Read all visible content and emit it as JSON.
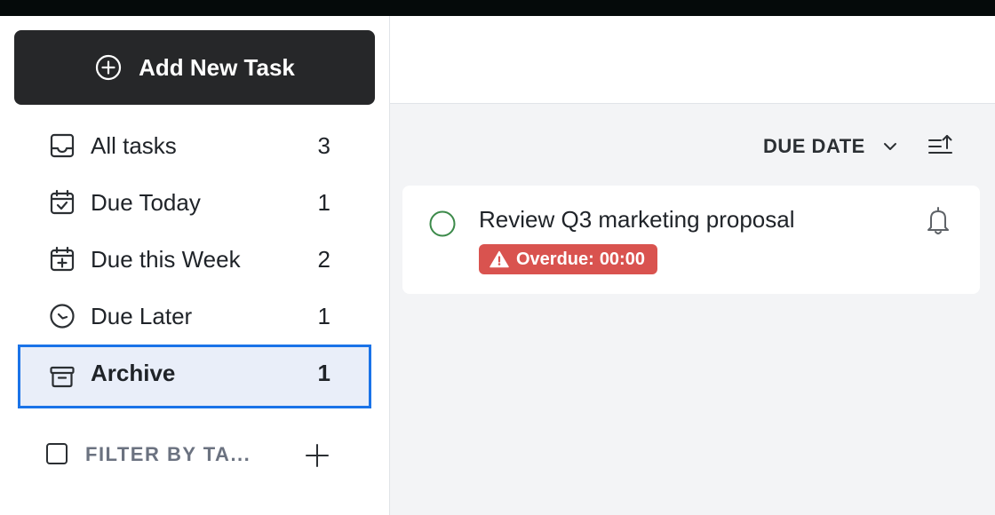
{
  "sidebar": {
    "add_button_label": "Add New Task",
    "items": [
      {
        "label": "All tasks",
        "count": "3",
        "icon": "inbox-icon"
      },
      {
        "label": "Due Today",
        "count": "1",
        "icon": "calendar-check-icon"
      },
      {
        "label": "Due this Week",
        "count": "2",
        "icon": "calendar-plus-icon"
      },
      {
        "label": "Due Later",
        "count": "1",
        "icon": "clock-icon"
      },
      {
        "label": "Archive",
        "count": "1",
        "icon": "archive-icon",
        "active": true
      }
    ],
    "filter_label": "FILTER BY TA..."
  },
  "main": {
    "sort_label": "DUE DATE",
    "tasks": [
      {
        "title": "Review Q3 marketing proposal",
        "badge_prefix": "Overdue:",
        "badge_time": "00:00"
      }
    ]
  },
  "colors": {
    "add_button_bg": "#262729",
    "active_border": "#1a73e8",
    "active_bg": "#e9eef9",
    "overdue_bg": "#d9534f",
    "check_circle": "#3c8a4a",
    "list_bg": "#f3f4f6"
  }
}
